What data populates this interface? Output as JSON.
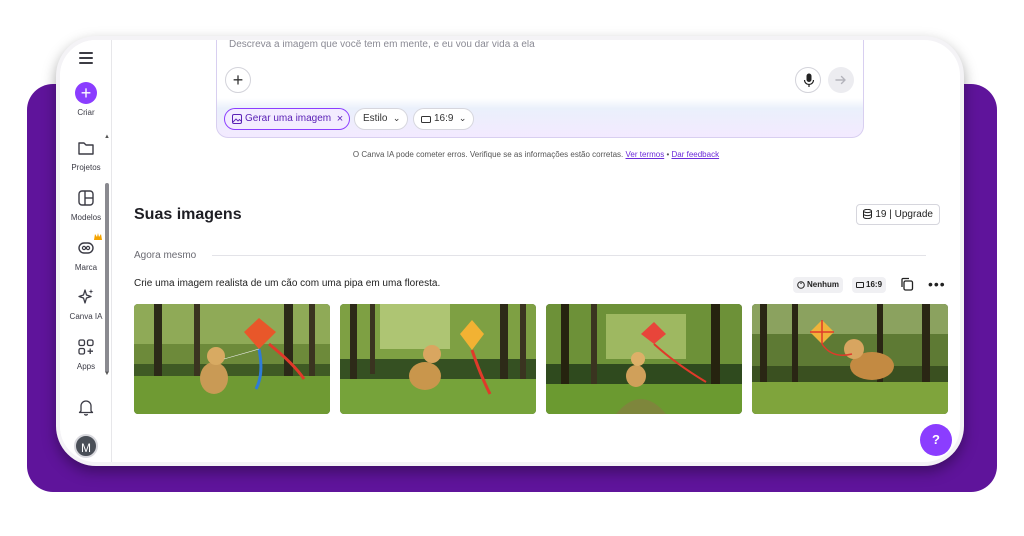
{
  "colors": {
    "brand_purple": "#8b3dff",
    "frame_purple": "#5f149b",
    "crown": "#f4a300"
  },
  "sidebar": {
    "create_label": "Criar",
    "items": [
      {
        "label": "Projetos",
        "icon": "folder-icon"
      },
      {
        "label": "Modelos",
        "icon": "templates-icon"
      },
      {
        "label": "Marca",
        "icon": "brand-icon"
      },
      {
        "label": "Canva IA",
        "icon": "sparkle-icon"
      },
      {
        "label": "Apps",
        "icon": "apps-icon"
      }
    ],
    "avatar_initial": "M"
  },
  "prompt": {
    "placeholder": "Descreva a imagem que você tem em mente, e eu vou dar vida a ela",
    "chips": {
      "generate": "Gerar uma imagem",
      "style": "Estilo",
      "ratio": "16:9"
    }
  },
  "disclaimer": {
    "text": "O Canva IA pode cometer erros. Verifique se as informações estão corretas.",
    "terms": "Ver termos",
    "separator": "•",
    "feedback": "Dar feedback"
  },
  "section": {
    "title": "Suas imagens",
    "credits": "19 | Upgrade",
    "time_label": "Agora mesmo"
  },
  "generation": {
    "prompt": "Crie uma imagem realista de um cão com uma pipa em uma floresta.",
    "style_tag": "Nenhum",
    "ratio_tag": "16:9"
  },
  "help": {
    "label": "?"
  }
}
